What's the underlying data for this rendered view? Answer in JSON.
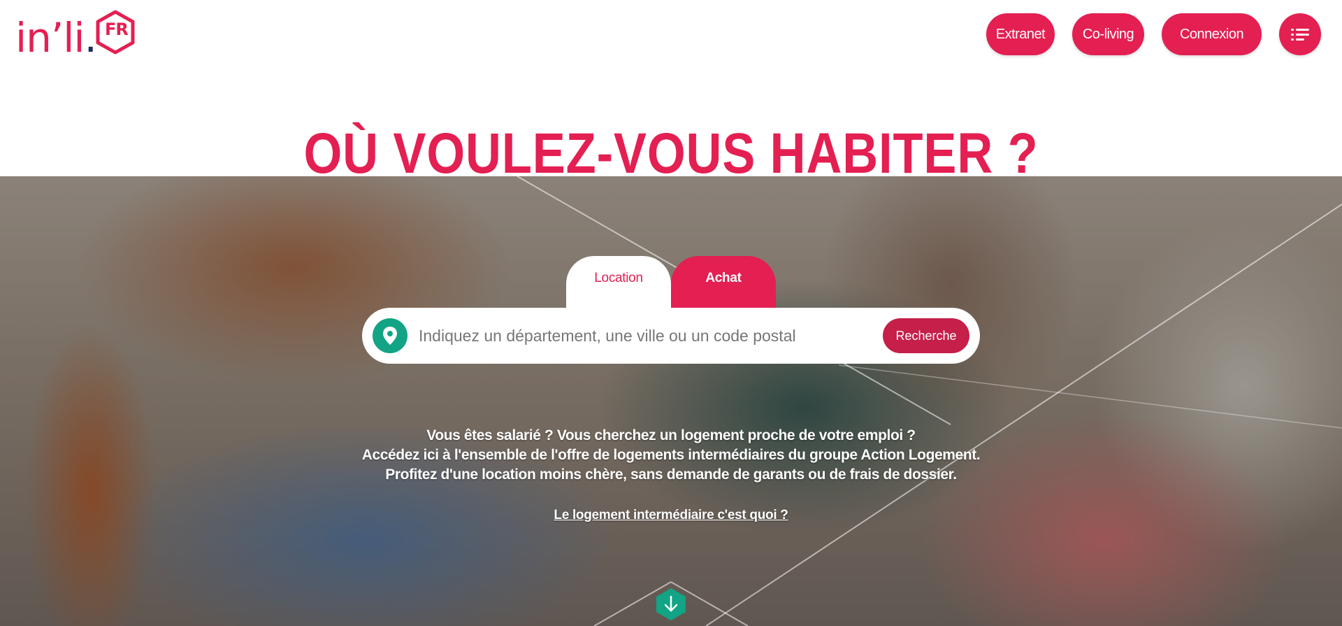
{
  "logo": {
    "word": "in’li",
    "dot": ".",
    "badge": "FR"
  },
  "nav": {
    "extranet": "Extranet",
    "coliving": "Co-living",
    "connexion": "Connexion",
    "menu_icon": "menu-lines-icon"
  },
  "hero": {
    "title": "OÙ VOULEZ-VOUS HABITER ?",
    "tabs": [
      {
        "label": "Location",
        "active": true
      },
      {
        "label": "Achat",
        "active": false
      }
    ],
    "search": {
      "placeholder": "Indiquez un département, une ville ou un code postal",
      "value": "",
      "button": "Recherche",
      "icon": "map-pin-icon"
    },
    "description": [
      "Vous êtes salarié ? Vous cherchez un logement proche de votre emploi ?",
      "Accédez ici à l'ensemble de l'offre de logements intermédiaires du groupe Action Logement.",
      "Profitez d'une location moins chère, sans demande de garants ou de frais de dossier."
    ],
    "link": "Le logement intermédiaire c'est quoi ?",
    "scroll_icon": "arrow-down-icon"
  },
  "colors": {
    "brand": "#e41f52",
    "search_button": "#c51f4a",
    "accent_green": "#12a484",
    "logo_dot": "#1d2d5c"
  }
}
